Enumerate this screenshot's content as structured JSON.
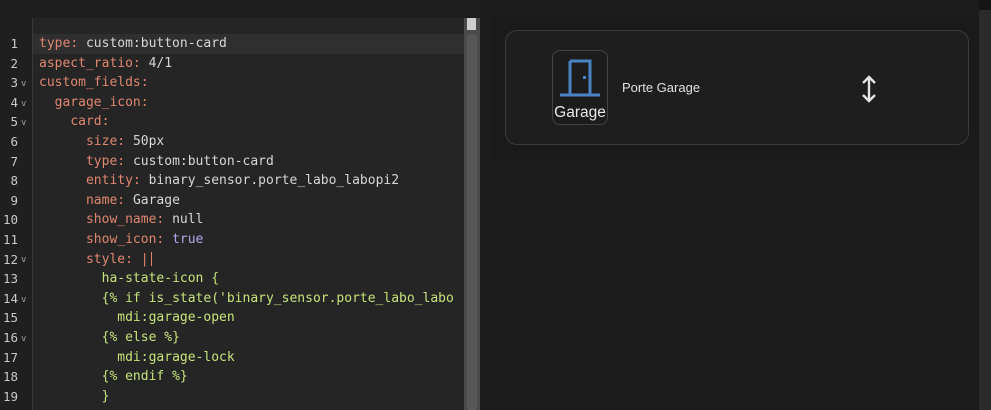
{
  "editor": {
    "line_numbers": [
      "1",
      "2",
      "3",
      "4",
      "5",
      "6",
      "7",
      "8",
      "9",
      "10",
      "11",
      "12",
      "13",
      "14",
      "15",
      "16",
      "17",
      "18",
      "19"
    ],
    "lines": [
      {
        "key": "type",
        "value": "custom:button-card"
      },
      {
        "key": "aspect_ratio",
        "value": "4/1"
      },
      {
        "key": "custom_fields"
      },
      {
        "key": "garage_icon"
      },
      {
        "key": "card"
      },
      {
        "key": "size",
        "value": "50px"
      },
      {
        "key": "type",
        "value": "custom:button-card"
      },
      {
        "key": "entity",
        "value": "binary_sensor.porte_labo_labopi2"
      },
      {
        "key": "name",
        "value": "Garage"
      },
      {
        "key": "show_name",
        "value": "null"
      },
      {
        "key": "show_icon",
        "value": "true"
      },
      {
        "key": "style",
        "value": "|"
      },
      {
        "text": "ha-state-icon {"
      },
      {
        "text": "{% if is_state('binary_sensor.porte_labo_labo"
      },
      {
        "text": "mdi:garage-open"
      },
      {
        "text": "{% else %}"
      },
      {
        "text": "mdi:garage-lock"
      },
      {
        "text": "{% endif %}"
      },
      {
        "text": "}"
      }
    ]
  },
  "preview": {
    "field_label": "Garage",
    "card_name": "Porte Garage",
    "icons": {
      "field": "door-icon",
      "state": "arrow-up-down-icon"
    },
    "colors": {
      "door_icon": "#4b84c4",
      "text": "#e0e0e0"
    }
  }
}
